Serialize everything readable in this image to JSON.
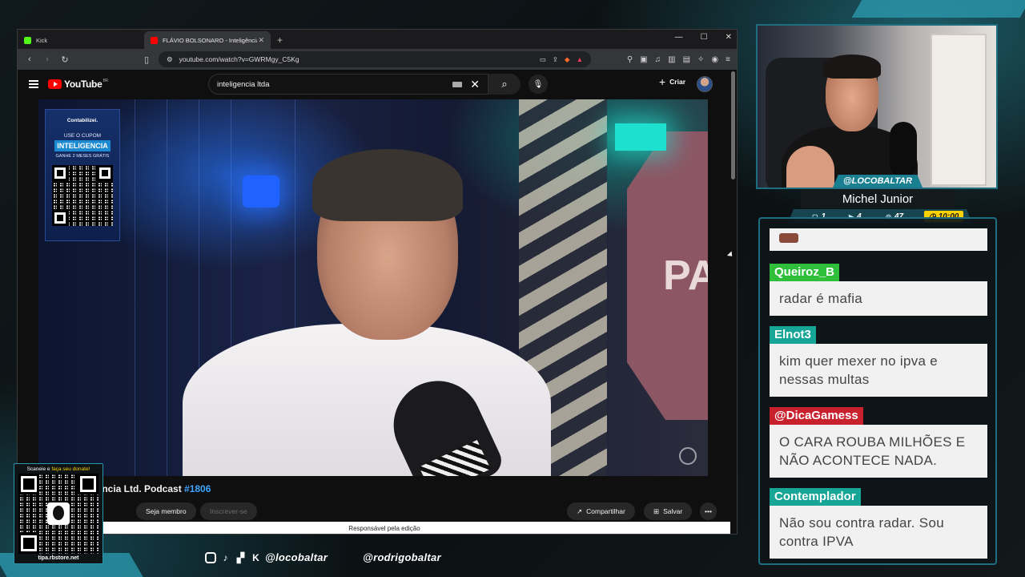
{
  "colors": {
    "accent_teal": "#2a97ad",
    "youtube_red": "#ff0000",
    "user_green": "#2fbf3a",
    "user_teal": "#16a596",
    "user_red": "#c8202c",
    "timer_yellow": "#ffd200"
  },
  "browser": {
    "tabs": [
      {
        "label": "Kick",
        "icon": "kick-icon"
      },
      {
        "label": "FLÁVIO BOLSONARO - Inteligência Ltd",
        "icon": "youtube-icon"
      }
    ],
    "new_tab_label": "+",
    "url": "youtube.com/watch?v=GWRMgy_C5Kg"
  },
  "youtube": {
    "logo_text": "YouTube",
    "logo_country": "BR",
    "search_value": "inteligencia ltda",
    "create_label": "Criar",
    "video_title_partial": "ARO - Inteligência Ltd. Podcast ",
    "video_number": "#1806",
    "member_button": "Seja membro",
    "subscribe_button": "Inscrever-se",
    "share_button": "Compartilhar",
    "save_button": "Salvar",
    "description_strip": "Responsável pela edição",
    "ad": {
      "brand": "Contabilizei.",
      "line1": "USE O CUPOM",
      "code": "INTELIGENCIA",
      "line2": "GANHE 2 MESES GRÁTIS"
    },
    "video_sign_text": "PA"
  },
  "donation": {
    "caption_prefix": "Scaneie e ",
    "caption_highlight": "faça seu donate!",
    "footer": "tipa.rbstore.net"
  },
  "socials": {
    "handle1": "@locobaltar",
    "handle2": "@rodrigobaltar"
  },
  "stream": {
    "handle": "@LOCOBALTAR",
    "name": "Michel Junior",
    "stats": {
      "chat": "1",
      "video": "4",
      "viewers": "47",
      "timer": "10:00"
    }
  },
  "chat": {
    "messages": [
      {
        "user": "Queiroz_B",
        "text": "radar é mafia",
        "color": "#2fbf3a"
      },
      {
        "user": "Elnot3",
        "text": "kim quer mexer no ipva e nessas multas",
        "color": "#16a596"
      },
      {
        "user": "@DicaGamess",
        "text": "O CARA ROUBA MILHÕES E NÃO ACONTECE NADA.",
        "color": "#c8202c"
      },
      {
        "user": "Contemplador",
        "text": "Não sou contra radar. Sou contra IPVA",
        "color": "#16a596"
      }
    ]
  }
}
